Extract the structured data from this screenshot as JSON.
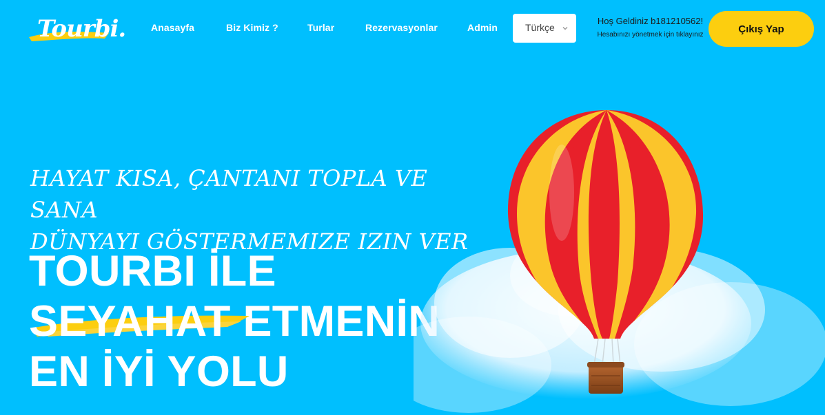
{
  "header": {
    "logo_text": "Tourbi.",
    "nav": [
      {
        "label": "Anasayfa"
      },
      {
        "label": "Biz Kimiz ?"
      },
      {
        "label": "Turlar"
      },
      {
        "label": "Rezervasyonlar"
      },
      {
        "label": "Admin"
      }
    ],
    "language_select": {
      "value": "Türkçe"
    },
    "welcome": {
      "greeting": "Hoş Geldiniz b181210562!",
      "manage_hint": "Hesabınızı yönetmek için tıklayınız"
    },
    "logout_label": "Çıkış Yap"
  },
  "hero": {
    "tagline_line1": "HAYAT KISA, ÇANTANI TOPLA VE SANA",
    "tagline_line2": "DÜNYAYI GÖSTERMEMIZE IZIN VER",
    "headline_line1": "TOURBI İLE",
    "headline_highlight": "SEYAHAT",
    "headline_line2_rest": " ETMENİN",
    "headline_line3": "EN İYİ YOLU"
  },
  "colors": {
    "background": "#00BFFE",
    "accent_yellow": "#FCCE0F",
    "balloon_red": "#E8202A",
    "balloon_yellow": "#FBC52B"
  },
  "icons": [
    "chevron-down-icon",
    "hot-air-balloon-illustration",
    "cloud-illustration"
  ]
}
